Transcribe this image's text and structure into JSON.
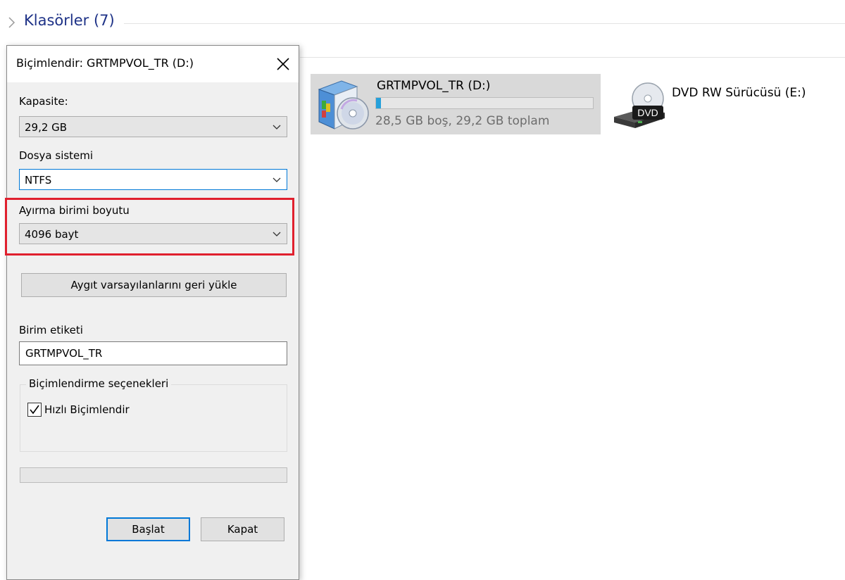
{
  "explorer": {
    "section_title": "Klasörler (7)",
    "drives": [
      {
        "name": "GRTMPVOL_TR (D:)",
        "space_text": "28,5 GB boş, 29,2 GB toplam",
        "used_fraction": 0.024,
        "icon": "setup-disc-drive-icon",
        "selected": true
      },
      {
        "name": "DVD RW Sürücüsü (E:)",
        "icon": "dvd-drive-icon",
        "icon_text": "DVD"
      }
    ]
  },
  "dialog": {
    "title": "Biçimlendir: GRTMPVOL_TR (D:)",
    "capacity": {
      "label": "Kapasite:",
      "value": "29,2 GB"
    },
    "file_system": {
      "label": "Dosya sistemi",
      "value": "NTFS"
    },
    "allocation_unit": {
      "label": "Ayırma birimi boyutu",
      "value": "4096 bayt"
    },
    "restore_defaults_button": "Aygıt varsayılanlarını geri yükle",
    "volume_label": {
      "label": "Birim etiketi",
      "value": "GRTMPVOL_TR"
    },
    "format_options": {
      "legend": "Biçimlendirme seçenekleri",
      "quick_format_label": "Hızlı Biçimlendir",
      "quick_format_checked": true
    },
    "progress_fraction": 0,
    "start_button": "Başlat",
    "close_button": "Kapat"
  },
  "colors": {
    "highlight": "#e0202e",
    "accent": "#0078d7",
    "drive_bar": "#26a0da",
    "section_title": "#1e3287"
  }
}
